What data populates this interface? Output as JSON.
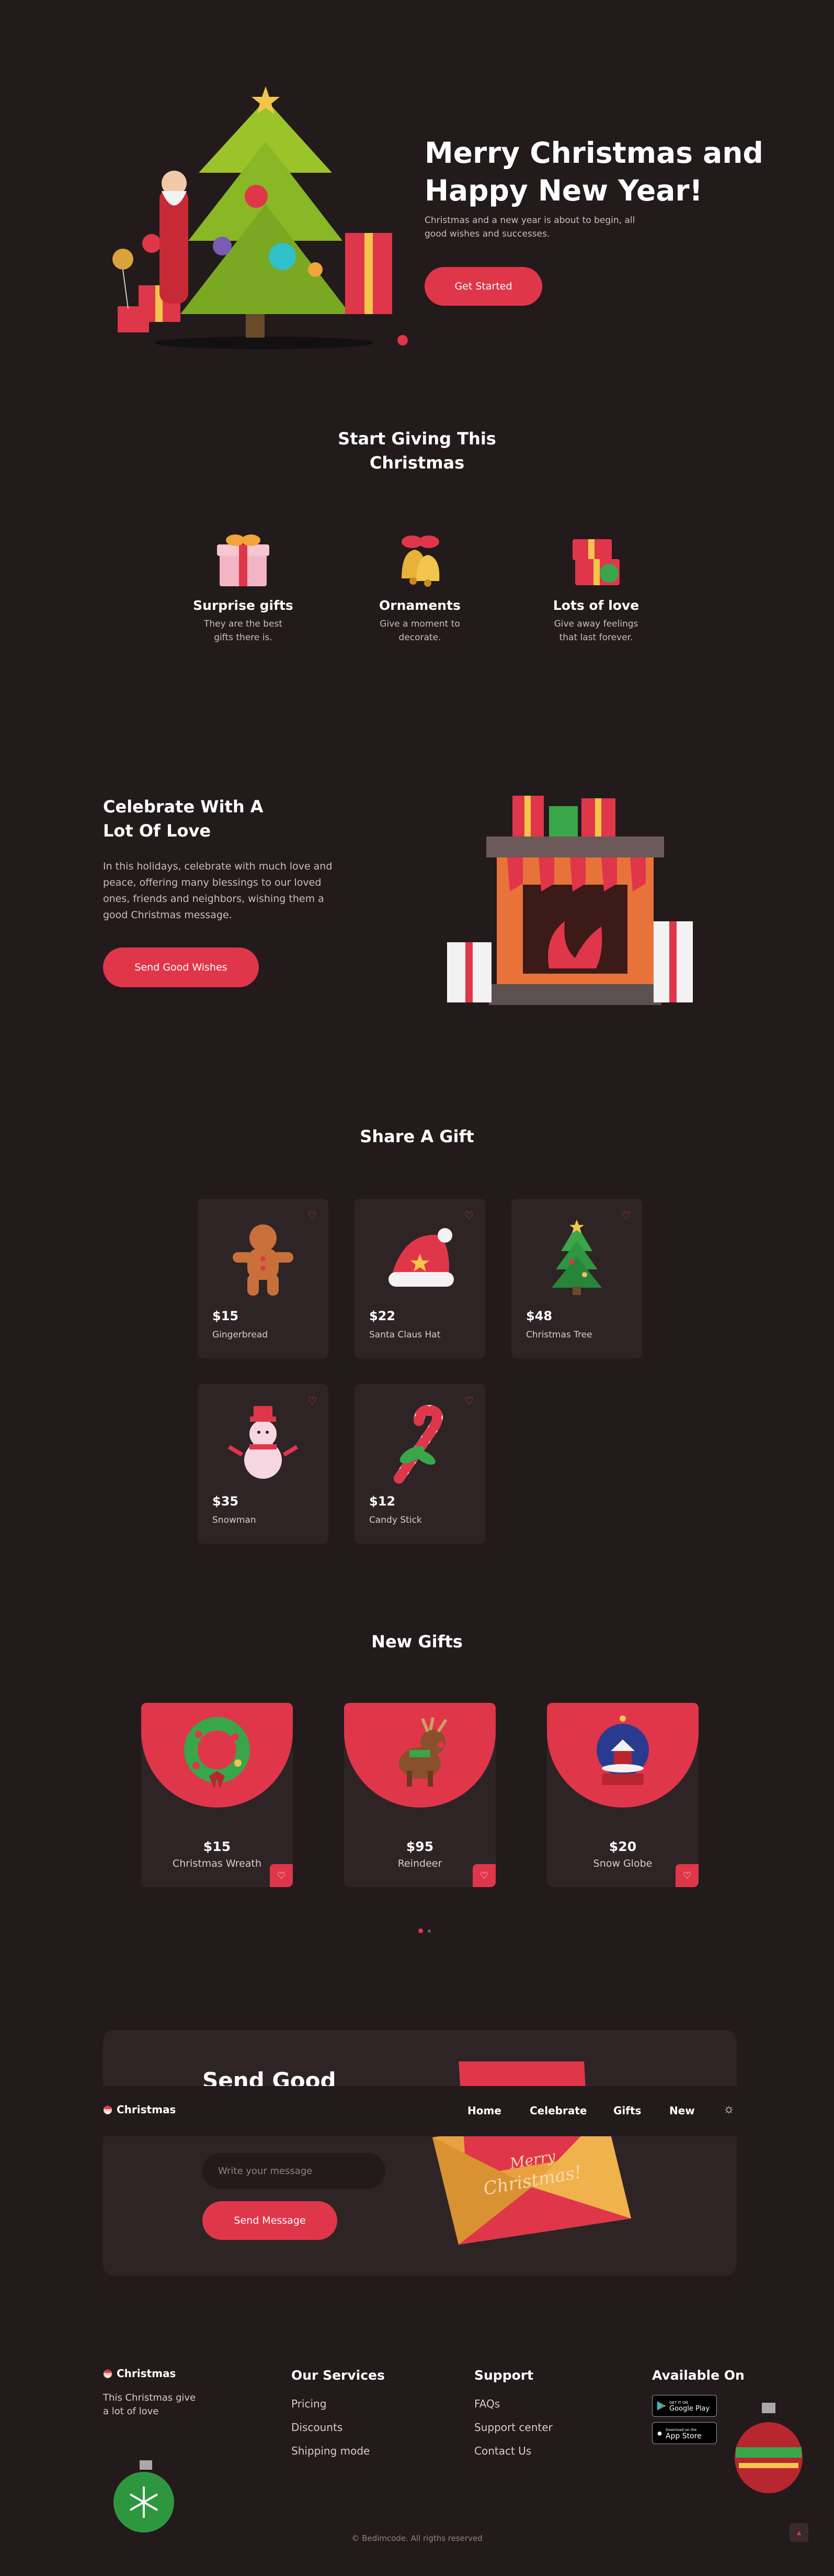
{
  "hero": {
    "title_line1": "Merry Christmas and",
    "title_line2": "Happy New Year!",
    "subtitle_line1": "Christmas and a new year is about to begin, all",
    "subtitle_line2": "good wishes and successes.",
    "cta": "Get Started"
  },
  "giving": {
    "title_line1": "Start Giving This",
    "title_line2": "Christmas",
    "items": [
      {
        "title": "Surprise gifts",
        "desc1": "They are the best",
        "desc2": "gifts there is."
      },
      {
        "title": "Ornaments",
        "desc1": "Give a moment to",
        "desc2": "decorate."
      },
      {
        "title": "Lots of love",
        "desc1": "Give away feelings",
        "desc2": "that last forever."
      }
    ]
  },
  "celebrate": {
    "title_line1": "Celebrate With A",
    "title_line2": "Lot Of Love",
    "para1": "In this holidays, celebrate with much love and",
    "para2": "peace, offering many blessings to our loved",
    "para3": "ones, friends and neighbors, wishing them a",
    "para4": "good Christmas message.",
    "cta": "Send Good Wishes"
  },
  "share": {
    "title": "Share A Gift",
    "items": [
      {
        "price": "$15",
        "name": "Gingerbread",
        "icon": "gingerbread-icon"
      },
      {
        "price": "$22",
        "name": "Santa Claus Hat",
        "icon": "santa-hat-icon"
      },
      {
        "price": "$48",
        "name": "Christmas Tree",
        "icon": "christmas-tree-icon"
      },
      {
        "price": "$35",
        "name": "Snowman",
        "icon": "snowman-icon"
      },
      {
        "price": "$12",
        "name": "Candy Stick",
        "icon": "candy-cane-icon"
      }
    ]
  },
  "new_gifts": {
    "title": "New Gifts",
    "items": [
      {
        "price": "$15",
        "name": "Christmas Wreath",
        "icon": "wreath-icon"
      },
      {
        "price": "$95",
        "name": "Reindeer",
        "icon": "reindeer-icon"
      },
      {
        "price": "$20",
        "name": "Snow Globe",
        "icon": "snow-globe-icon"
      }
    ]
  },
  "message": {
    "title_partial": "Send Good",
    "placeholder": "Write your message",
    "cta": "Send Message",
    "card_text1": "Merry",
    "card_text2": "Christmas!"
  },
  "nav": {
    "brand": "Christmas",
    "links": [
      "Home",
      "Celebrate",
      "Gifts",
      "New"
    ]
  },
  "footer": {
    "brand": "Christmas",
    "tagline1": "This Christmas give",
    "tagline2": "a lot of love",
    "services_title": "Our Services",
    "services": [
      "Pricing",
      "Discounts",
      "Shipping mode"
    ],
    "support_title": "Support",
    "support": [
      "FAQs",
      "Support center",
      "Contact Us"
    ],
    "available_title": "Available On",
    "google_small": "GET IT ON",
    "google": "Google Play",
    "apple_small": "Download on the",
    "apple": "App Store",
    "copyright": "© Bedimcode. All rigths reserved"
  },
  "colors": {
    "background": "#231a1b",
    "card": "#2e2425",
    "accent": "#e0364a"
  }
}
